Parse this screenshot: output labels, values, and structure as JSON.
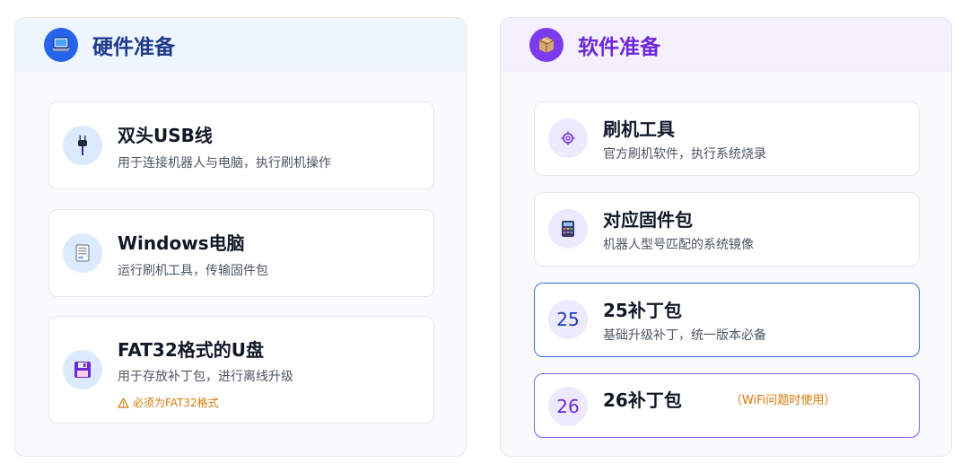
{
  "hardware": {
    "title": "硬件准备",
    "icon": "laptop-icon",
    "items": [
      {
        "title": "双头USB线",
        "desc": "用于连接机器人与电脑，执行刷机操作",
        "icon": "usb-plug-icon"
      },
      {
        "title": "Windows电脑",
        "desc": "运行刷机工具，传输固件包",
        "icon": "computer-icon"
      },
      {
        "title": "FAT32格式的U盘",
        "desc": "用于存放补丁包，进行离线升级",
        "warning": "必须为FAT32格式",
        "icon": "floppy-disk-icon"
      }
    ]
  },
  "software": {
    "title": "软件准备",
    "icon": "package-icon",
    "items": [
      {
        "title": "刷机工具",
        "desc": "官方刷机软件，执行系统烧录",
        "icon": "gear-icon"
      },
      {
        "title": "对应固件包",
        "desc": "机器人型号匹配的系统镜像",
        "icon": "calculator-icon"
      },
      {
        "title": "25补丁包",
        "desc": "基础升级补丁，统一版本必备",
        "badge": "25"
      },
      {
        "title": "26补丁包",
        "note": "（WiFi问题时使用）",
        "badge": "26"
      }
    ]
  },
  "colors": {
    "hardware_accent": "#2563eb",
    "software_accent": "#7c3aed",
    "warning": "#d97706"
  }
}
